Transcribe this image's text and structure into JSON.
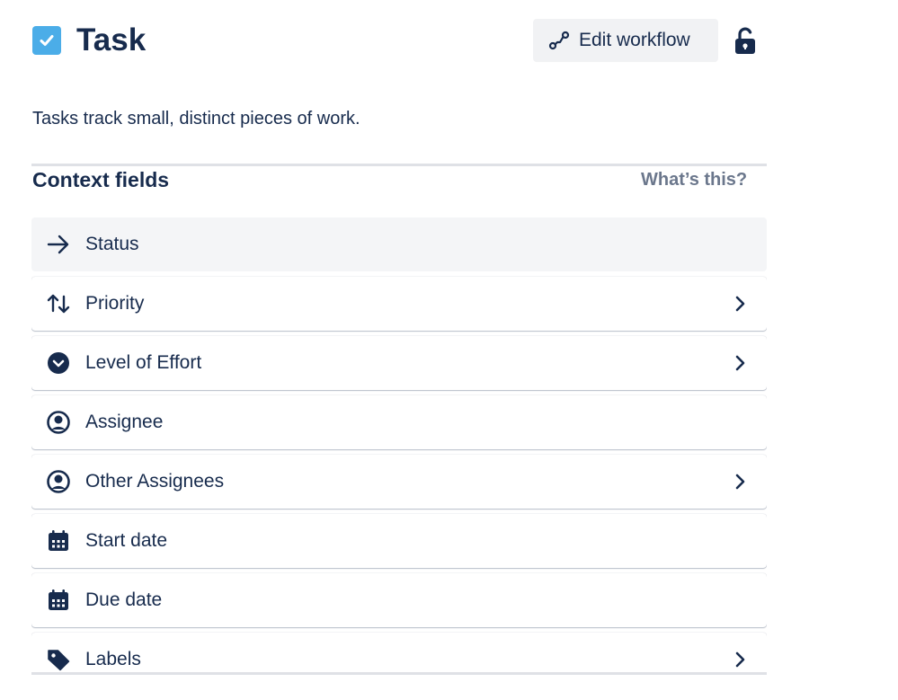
{
  "header": {
    "title": "Task",
    "edit_workflow_label": "Edit workflow",
    "icons": {
      "task": "task-checkbox-icon",
      "workflow": "workflow-icon",
      "lock": "unlocked-padlock-icon"
    },
    "colors": {
      "task_icon": "#4bade8",
      "button_bg": "#f1f2f4",
      "text": "#172b4d"
    }
  },
  "description": "Tasks track small, distinct pieces of work.",
  "context": {
    "title": "Context fields",
    "help_link": "What’s this?",
    "fields": [
      {
        "label": "Status",
        "icon": "arrow-right-icon",
        "has_chevron": false
      },
      {
        "label": "Priority",
        "icon": "sort-arrows-icon",
        "has_chevron": true
      },
      {
        "label": "Level of Effort",
        "icon": "dropdown-circle-icon",
        "has_chevron": true
      },
      {
        "label": "Assignee",
        "icon": "user-avatar-icon",
        "has_chevron": false
      },
      {
        "label": "Other Assignees",
        "icon": "user-avatar-icon",
        "has_chevron": true
      },
      {
        "label": "Start date",
        "icon": "calendar-icon",
        "has_chevron": false
      },
      {
        "label": "Due date",
        "icon": "calendar-icon",
        "has_chevron": false
      },
      {
        "label": "Labels",
        "icon": "tag-icon",
        "has_chevron": true
      }
    ]
  }
}
